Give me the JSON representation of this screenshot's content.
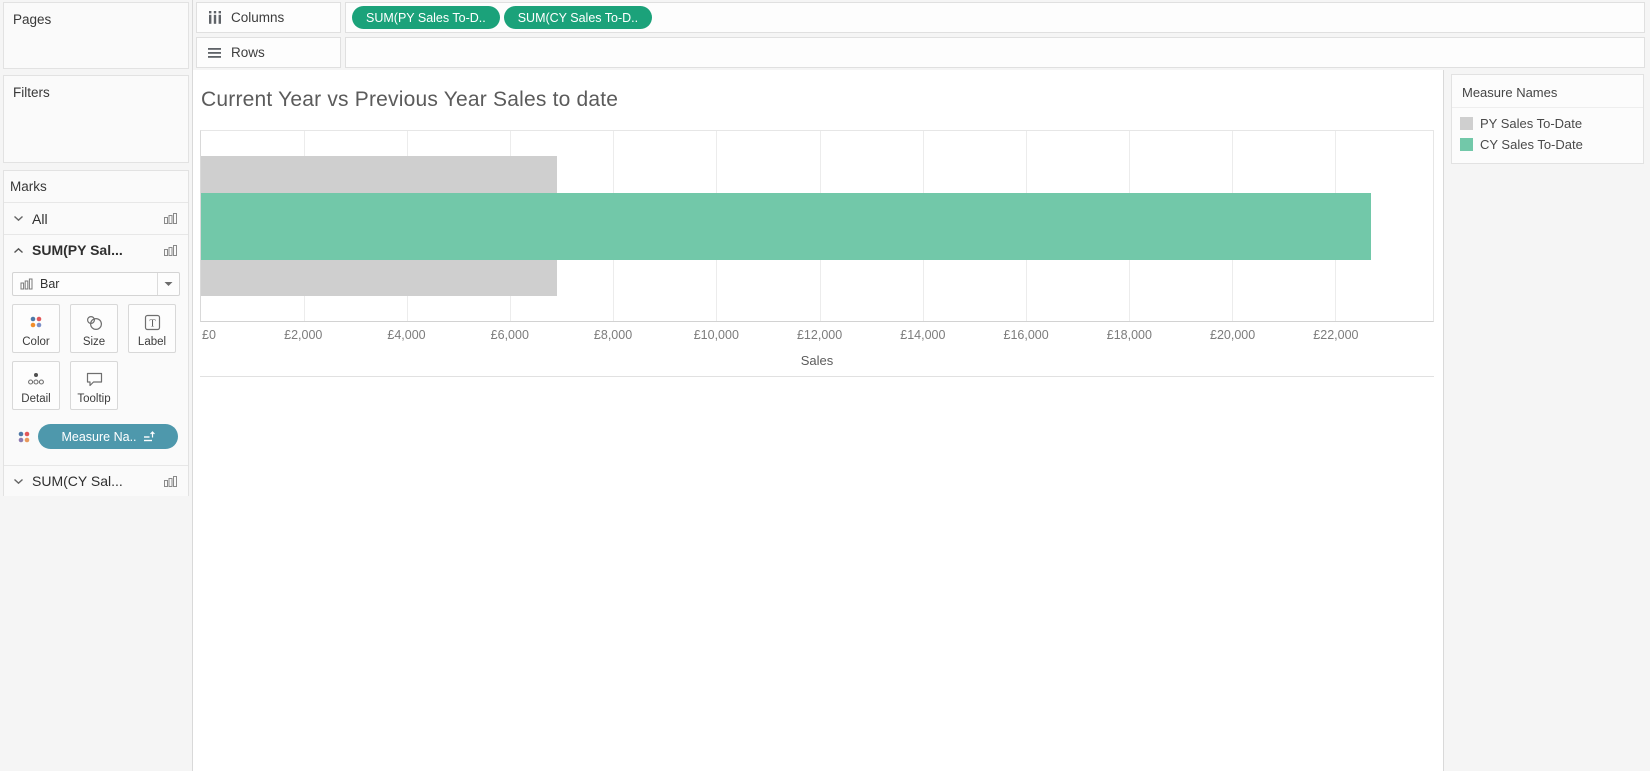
{
  "colors": {
    "pill_green": "#1ba27a",
    "measure_pill_blue": "#4e98ac",
    "bar_gray": "#cfcfcf",
    "bar_green": "#72c8a9"
  },
  "shelves": {
    "columns_label": "Columns",
    "rows_label": "Rows",
    "columns_pills": [
      {
        "label": "SUM(PY Sales To-D.."
      },
      {
        "label": "SUM(CY Sales To-D.."
      }
    ]
  },
  "sidebar": {
    "pages_label": "Pages",
    "filters_label": "Filters",
    "marks": {
      "header": "Marks",
      "rows": {
        "all": "All",
        "py": "SUM(PY Sal...",
        "cy": "SUM(CY Sal..."
      },
      "mark_type": "Bar",
      "buttons": [
        {
          "label": "Color"
        },
        {
          "label": "Size"
        },
        {
          "label": "Label"
        },
        {
          "label": "Detail"
        },
        {
          "label": "Tooltip"
        }
      ],
      "measure_pill": "Measure Na.."
    }
  },
  "legend": {
    "title": "Measure Names",
    "items": [
      {
        "label": "PY Sales To-Date",
        "color": "#cfcfcf"
      },
      {
        "label": "CY Sales To-Date",
        "color": "#72c8a9"
      }
    ]
  },
  "chart_data": {
    "type": "bar",
    "orientation": "horizontal",
    "title": "Current Year vs Previous Year Sales to date",
    "xlabel": "Sales",
    "xlim": [
      0,
      23900
    ],
    "grid": true,
    "legend_position": "right",
    "x_ticks": [
      {
        "value": 0,
        "label": "£0"
      },
      {
        "value": 2000,
        "label": "£2,000"
      },
      {
        "value": 4000,
        "label": "£4,000"
      },
      {
        "value": 6000,
        "label": "£6,000"
      },
      {
        "value": 8000,
        "label": "£8,000"
      },
      {
        "value": 10000,
        "label": "£10,000"
      },
      {
        "value": 12000,
        "label": "£12,000"
      },
      {
        "value": 14000,
        "label": "£14,000"
      },
      {
        "value": 16000,
        "label": "£16,000"
      },
      {
        "value": 18000,
        "label": "£18,000"
      },
      {
        "value": 20000,
        "label": "£20,000"
      },
      {
        "value": 22000,
        "label": "£22,000"
      }
    ],
    "series": [
      {
        "name": "PY Sales To-Date",
        "value": 6900,
        "color": "#cfcfcf",
        "thickness_px": 140
      },
      {
        "name": "CY Sales To-Date",
        "value": 22700,
        "color": "#72c8a9",
        "thickness_px": 67
      }
    ]
  }
}
